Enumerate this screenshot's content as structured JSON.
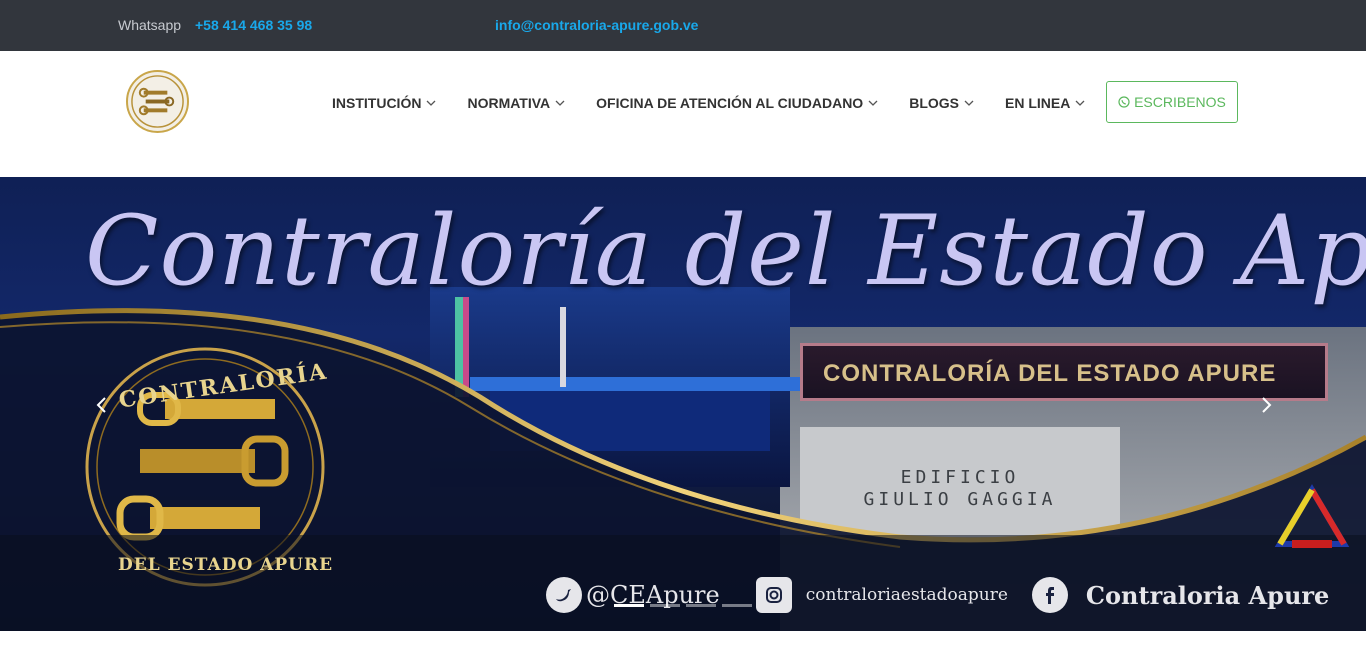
{
  "topbar": {
    "whatsapp_label": "Whatsapp",
    "whatsapp_phone": "+58 414 468 35 98",
    "email": "info@contraloria-apure.gob.ve"
  },
  "header": {
    "logo_icon": "contraloria-seal-logo",
    "nav": [
      {
        "label": "INSTITUCIÓN"
      },
      {
        "label": "NORMATIVA"
      },
      {
        "label": "OFICINA DE ATENCIÓN AL CIUDADANO"
      },
      {
        "label": "BLOGS"
      },
      {
        "label": "EN LINEA"
      }
    ],
    "cta_label": "ESCRIBENOS"
  },
  "hero": {
    "title": "Contraloría del Estado Apure",
    "seal_top": "CONTRALORÍA",
    "seal_bottom": "DEL ESTADO APURE",
    "sign_text": "CONTRALORÍA DEL ESTADO APURE",
    "building_line1": "EDIFICIO",
    "building_line2": "GIULIO GAGGIA",
    "twitter_handle": "@CEApure",
    "instagram_handle": "contraloriaestadoapure",
    "facebook_name": "Contraloria Apure",
    "slides_count": 4,
    "active_slide": 1
  },
  "colors": {
    "topbar_bg": "#32363d",
    "link_blue": "#19a8ea",
    "cta_green": "#5bb85d",
    "hero_gold": "#d9b04a"
  }
}
